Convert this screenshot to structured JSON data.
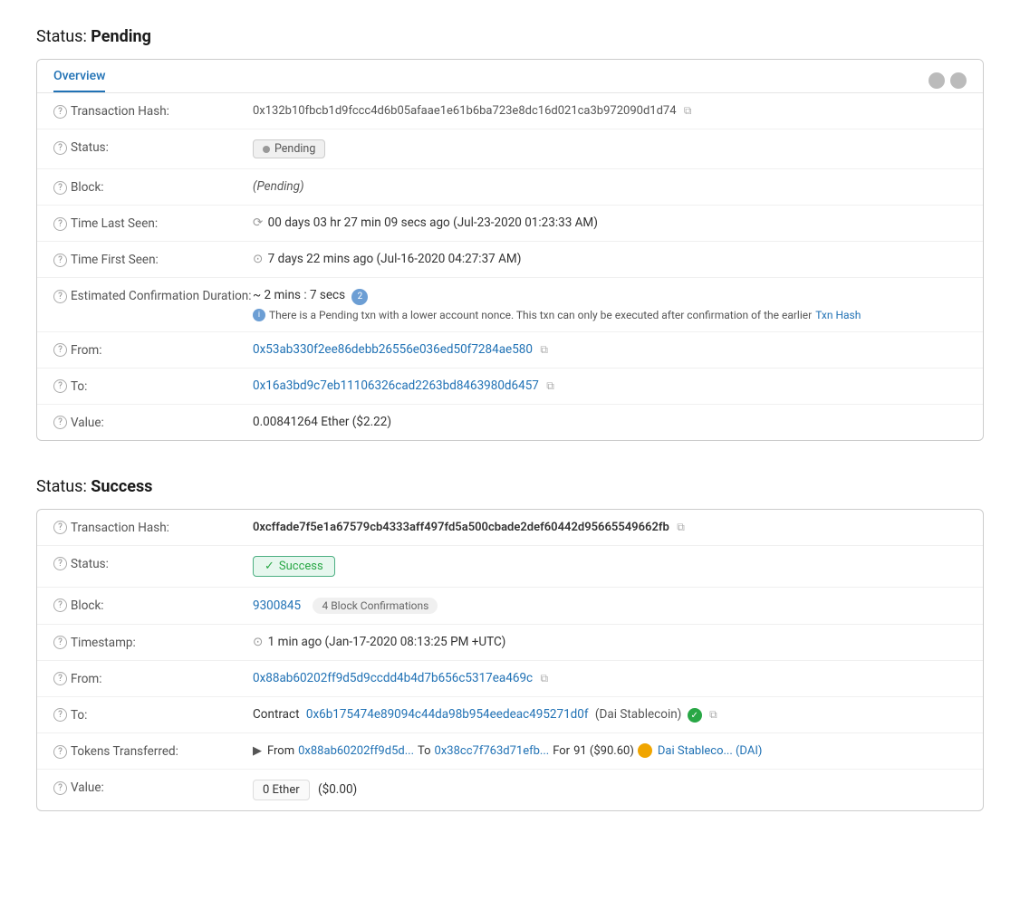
{
  "pending_section": {
    "title": "Status:",
    "title_bold": "Pending",
    "tab": {
      "label": "Overview",
      "icons": [
        "circle1",
        "circle2"
      ]
    },
    "rows": [
      {
        "id": "tx-hash",
        "label": "Transaction Hash:",
        "value": "0x132b10fbcb1d9fccc4d6b05afaae1e61b6ba723e8dc16d021ca3b972090d1d74",
        "has_copy": true,
        "type": "hash"
      },
      {
        "id": "status",
        "label": "Status:",
        "value": "Pending",
        "type": "badge-pending"
      },
      {
        "id": "block",
        "label": "Block:",
        "value": "(Pending)",
        "type": "italic"
      },
      {
        "id": "time-last-seen",
        "label": "Time Last Seen:",
        "value": "00 days 03 hr 27 min 09 secs ago (Jul-23-2020 01:23:33 AM)",
        "type": "clock"
      },
      {
        "id": "time-first-seen",
        "label": "Time First Seen:",
        "value": "7 days 22 mins ago (Jul-16-2020 04:27:37 AM)",
        "type": "clock"
      },
      {
        "id": "est-confirmation",
        "label": "Estimated Confirmation Duration:",
        "value": "~ 2 mins : 7 secs",
        "note": "There is a Pending txn with a lower account nonce. This txn can only be executed after confirmation of the earlier",
        "note_link": "Txn Hash",
        "type": "confirmation"
      },
      {
        "id": "from",
        "label": "From:",
        "value": "0x53ab330f2ee86debb26556e036ed50f7284ae580",
        "has_copy": true,
        "type": "link"
      },
      {
        "id": "to",
        "label": "To:",
        "value": "0x16a3bd9c7eb11106326cad2263bd8463980d6457",
        "has_copy": true,
        "type": "link"
      },
      {
        "id": "value",
        "label": "Value:",
        "value": "0.00841264 Ether ($2.22)",
        "type": "text"
      }
    ]
  },
  "success_section": {
    "title": "Status:",
    "title_bold": "Success",
    "rows": [
      {
        "id": "tx-hash",
        "label": "Transaction Hash:",
        "value": "0xcffade7f5e1a67579cb4333aff497fd5a500cbade2def60442d95665549662fb",
        "has_copy": true,
        "type": "hash-bold"
      },
      {
        "id": "status",
        "label": "Status:",
        "value": "Success",
        "type": "badge-success"
      },
      {
        "id": "block",
        "label": "Block:",
        "block_value": "9300845",
        "confirmations": "4 Block Confirmations",
        "type": "block"
      },
      {
        "id": "timestamp",
        "label": "Timestamp:",
        "value": "1 min ago (Jan-17-2020 08:13:25 PM +UTC)",
        "type": "clock"
      },
      {
        "id": "from",
        "label": "From:",
        "value": "0x88ab60202ff9d5d9ccdd4b4d7b656c5317ea469c",
        "has_copy": true,
        "type": "link"
      },
      {
        "id": "to",
        "label": "To:",
        "contract_prefix": "Contract",
        "contract_address": "0x6b175474e89094c44da98b954eedeac495271d0f",
        "contract_name": "(Dai Stablecoin)",
        "has_copy": true,
        "type": "contract"
      },
      {
        "id": "tokens-transferred",
        "label": "Tokens Transferred:",
        "from_addr": "0x88ab60202ff9d5d...",
        "to_addr": "0x38cc7f763d71efb...",
        "amount": "91 ($90.60)",
        "token_name": "Dai Stableco... (DAI)",
        "type": "token-transfer"
      },
      {
        "id": "value",
        "label": "Value:",
        "box_value": "0 Ether",
        "extra_value": "($0.00)",
        "type": "value-box"
      }
    ]
  },
  "labels": {
    "help": "?",
    "copy": "⧉",
    "clock": "⊙",
    "spinner": "⟳",
    "check": "✓",
    "arrow_right": "▶",
    "info": "i"
  }
}
